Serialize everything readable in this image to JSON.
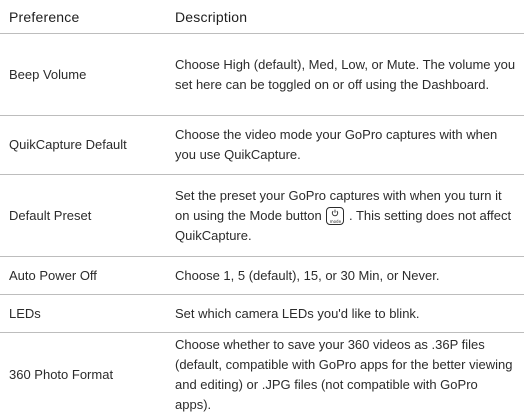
{
  "header": {
    "preference": "Preference",
    "description": "Description"
  },
  "rows": [
    {
      "preference": "Beep Volume",
      "description": "Choose High (default), Med, Low, or Mute. The volume you set here can be toggled on or off using the Dashboard."
    },
    {
      "preference": "QuikCapture Default",
      "description": "Choose the video mode your GoPro captures with when you use QuikCapture."
    },
    {
      "preference": "Default Preset",
      "description_before_icon": "Set the preset your GoPro captures with when you turn it on using the Mode button",
      "description_after_icon": ". This setting does not affect QuikCapture.",
      "icon": "mode-button-icon",
      "icon_label": "mode"
    },
    {
      "preference": "Auto Power Off",
      "description": "Choose 1, 5 (default), 15, or 30 Min, or Never."
    },
    {
      "preference": "LEDs",
      "description": "Set which camera LEDs you'd like to blink."
    },
    {
      "preference": "360 Photo Format",
      "description": "Choose whether to save your 360 videos as .36P files (default, compatible with GoPro apps for the better viewing and editing) or .JPG files (not compatible with GoPro apps)."
    }
  ]
}
